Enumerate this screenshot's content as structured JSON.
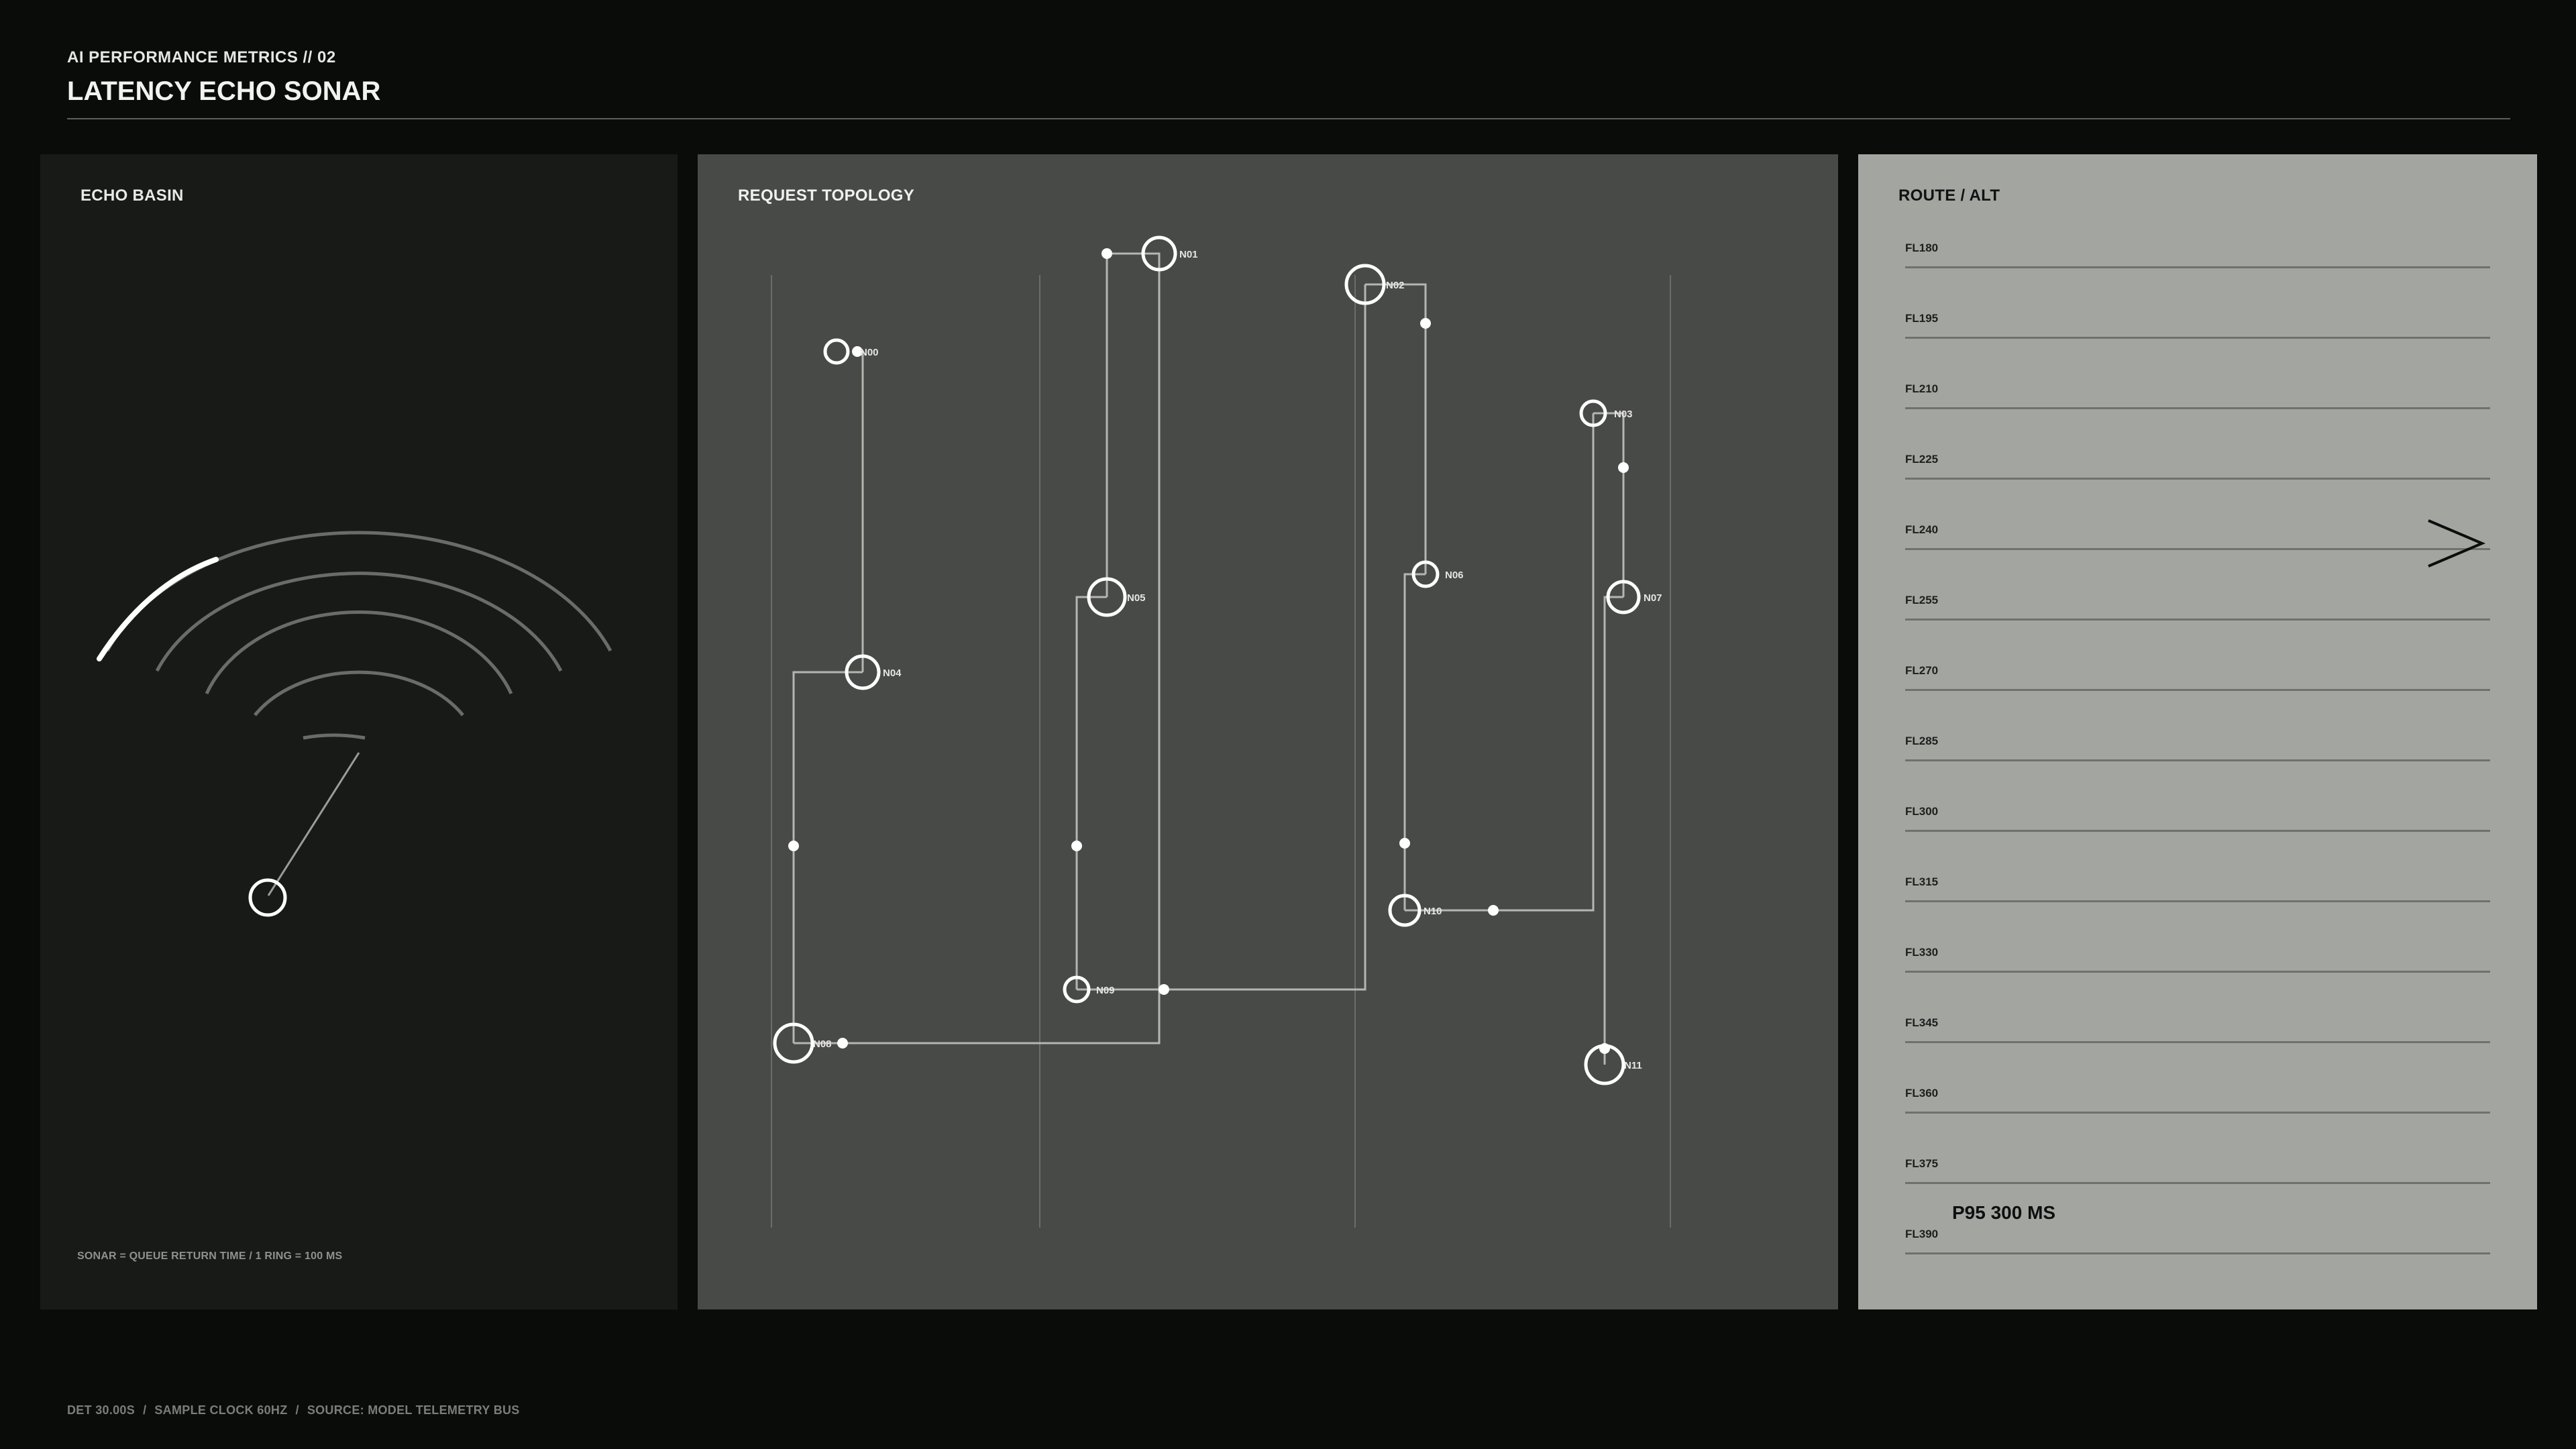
{
  "header": {
    "kicker": "AI PERFORMANCE METRICS // 02",
    "title": "LATENCY ECHO SONAR"
  },
  "echo_basin": {
    "title": "ECHO BASIN",
    "caption": "SONAR = QUEUE RETURN TIME / 1 RING = 100 MS"
  },
  "topology": {
    "title": "REQUEST TOPOLOGY",
    "nodes": [
      "N00",
      "N01",
      "N02",
      "N03",
      "N04",
      "N05",
      "N06",
      "N07",
      "N08",
      "N09",
      "N10",
      "N11"
    ]
  },
  "route": {
    "title": "ROUTE / ALT",
    "levels": [
      "FL180",
      "FL195",
      "FL210",
      "FL225",
      "FL240",
      "FL255",
      "FL270",
      "FL285",
      "FL300",
      "FL315",
      "FL330",
      "FL345",
      "FL360",
      "FL375",
      "FL390"
    ],
    "current_level": "FL240",
    "p95": "P95 300 MS"
  },
  "footer": {
    "det": "DET 30.00S",
    "clock": "SAMPLE CLOCK 60HZ",
    "source": "SOURCE: MODEL TELEMETRY BUS"
  },
  "colors": {
    "background": "#0a0c0a",
    "echo_panel": "#181a18",
    "topology_panel": "#484a47",
    "route_panel": "#a3a5a1",
    "accent_white": "#ffffff"
  }
}
